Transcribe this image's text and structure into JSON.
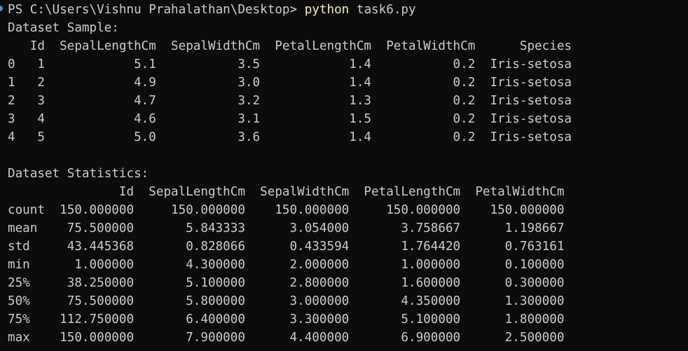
{
  "terminal": {
    "prompt": "PS C:\\Users\\Vishnu Prahalathan\\Desktop> ",
    "command": "python",
    "args": " task6.py",
    "marker_color": "#3a96dd",
    "command_color": "#f9f1a5",
    "text_color": "#cccccc",
    "background_color": "#0c0c0c"
  },
  "sample": {
    "title": "Dataset Sample:",
    "header": "   Id  SepalLengthCm  SepalWidthCm  PetalLengthCm  PetalWidthCm      Species",
    "rows": [
      "0   1            5.1           3.5            1.4           0.2  Iris-setosa",
      "1   2            4.9           3.0            1.4           0.2  Iris-setosa",
      "2   3            4.7           3.2            1.3           0.2  Iris-setosa",
      "3   4            4.6           3.1            1.5           0.2  Iris-setosa",
      "4   5            5.0           3.6            1.4           0.2  Iris-setosa"
    ]
  },
  "stats": {
    "title": "Dataset Statistics:",
    "header": "               Id  SepalLengthCm  SepalWidthCm  PetalLengthCm  PetalWidthCm",
    "rows": [
      "count  150.000000     150.000000    150.000000     150.000000    150.000000",
      "mean    75.500000       5.843333      3.054000       3.758667      1.198667",
      "std     43.445368       0.828066      0.433594       1.764420      0.763161",
      "min      1.000000       4.300000      2.000000       1.000000      0.100000",
      "25%     38.250000       5.100000      2.800000       1.600000      0.300000",
      "50%     75.500000       5.800000      3.000000       4.350000      1.300000",
      "75%    112.750000       6.400000      3.300000       5.100000      1.800000",
      "max    150.000000       7.900000      4.400000       6.900000      2.500000"
    ]
  }
}
